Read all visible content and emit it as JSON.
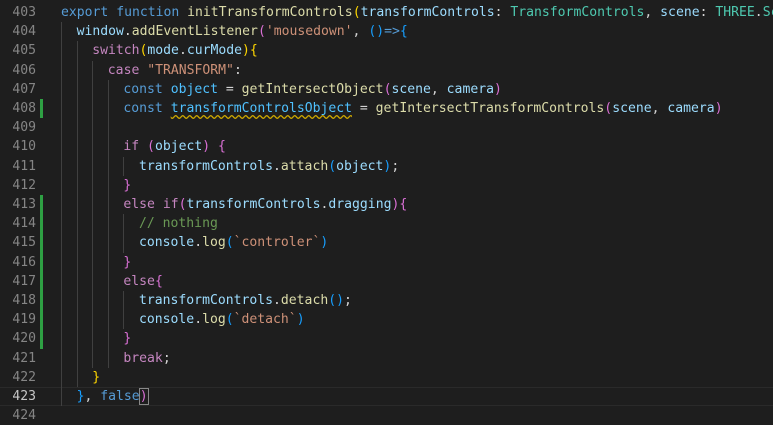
{
  "lines": [
    {
      "num": "403",
      "indent": 0,
      "git": false,
      "current": false,
      "tokens": [
        [
          "export ",
          "kw"
        ],
        [
          "function ",
          "kw"
        ],
        [
          "initTransformControls",
          "fn"
        ],
        [
          "(",
          "b1"
        ],
        [
          "transformControls",
          "var"
        ],
        [
          ": ",
          "txt"
        ],
        [
          "TransformControls",
          "typ"
        ],
        [
          ", ",
          "txt"
        ],
        [
          "scene",
          "var"
        ],
        [
          ": ",
          "txt"
        ],
        [
          "THREE",
          "typ"
        ],
        [
          ".",
          "txt"
        ],
        [
          "Scene",
          "typ"
        ]
      ]
    },
    {
      "num": "404",
      "indent": 1,
      "git": false,
      "current": false,
      "tokens": [
        [
          "window",
          "var"
        ],
        [
          ".",
          "txt"
        ],
        [
          "addEventListener",
          "fn"
        ],
        [
          "(",
          "b2"
        ],
        [
          "'mousedown'",
          "str"
        ],
        [
          ", ",
          "txt"
        ],
        [
          "()",
          "b3"
        ],
        [
          "=>",
          "kw"
        ],
        [
          "{",
          "b3"
        ]
      ]
    },
    {
      "num": "405",
      "indent": 2,
      "git": false,
      "current": false,
      "tokens": [
        [
          "switch",
          "ctl"
        ],
        [
          "(",
          "b1"
        ],
        [
          "mode",
          "var"
        ],
        [
          ".",
          "txt"
        ],
        [
          "curMode",
          "var"
        ],
        [
          ")",
          "b1"
        ],
        [
          "{",
          "b1"
        ]
      ]
    },
    {
      "num": "406",
      "indent": 3,
      "git": false,
      "current": false,
      "tokens": [
        [
          "case ",
          "ctl"
        ],
        [
          "\"TRANSFORM\"",
          "str"
        ],
        [
          ":",
          "txt"
        ]
      ]
    },
    {
      "num": "407",
      "indent": 4,
      "git": false,
      "current": false,
      "tokens": [
        [
          "const ",
          "kw"
        ],
        [
          "object",
          "cst"
        ],
        [
          " = ",
          "txt"
        ],
        [
          "getIntersectObject",
          "fn"
        ],
        [
          "(",
          "b2"
        ],
        [
          "scene",
          "var"
        ],
        [
          ", ",
          "txt"
        ],
        [
          "camera",
          "var"
        ],
        [
          ")",
          "b2"
        ]
      ]
    },
    {
      "num": "408",
      "indent": 4,
      "git": true,
      "current": false,
      "tokens": [
        [
          "const ",
          "kw"
        ],
        [
          "transformControlsObject",
          "cst",
          "warn"
        ],
        [
          " = ",
          "txt"
        ],
        [
          "getIntersectTransformControls",
          "fn"
        ],
        [
          "(",
          "b2"
        ],
        [
          "scene",
          "var"
        ],
        [
          ", ",
          "txt"
        ],
        [
          "camera",
          "var"
        ],
        [
          ")",
          "b2"
        ]
      ]
    },
    {
      "num": "409",
      "indent": 4,
      "git": false,
      "current": false,
      "tokens": []
    },
    {
      "num": "410",
      "indent": 4,
      "git": false,
      "current": false,
      "tokens": [
        [
          "if ",
          "ctl"
        ],
        [
          "(",
          "b2"
        ],
        [
          "object",
          "var"
        ],
        [
          ")",
          "b2"
        ],
        [
          " ",
          "txt"
        ],
        [
          "{",
          "b2"
        ]
      ]
    },
    {
      "num": "411",
      "indent": 5,
      "git": false,
      "current": false,
      "tokens": [
        [
          "transformControls",
          "var"
        ],
        [
          ".",
          "txt"
        ],
        [
          "attach",
          "fn"
        ],
        [
          "(",
          "b3"
        ],
        [
          "object",
          "var"
        ],
        [
          ")",
          "b3"
        ],
        [
          ";",
          "txt"
        ]
      ]
    },
    {
      "num": "412",
      "indent": 4,
      "git": false,
      "current": false,
      "tokens": [
        [
          "}",
          "b2"
        ]
      ]
    },
    {
      "num": "413",
      "indent": 4,
      "git": true,
      "current": false,
      "tokens": [
        [
          "else ",
          "ctl"
        ],
        [
          "if",
          "ctl"
        ],
        [
          "(",
          "b2"
        ],
        [
          "transformControls",
          "var"
        ],
        [
          ".",
          "txt"
        ],
        [
          "dragging",
          "var"
        ],
        [
          ")",
          "b2"
        ],
        [
          "{",
          "b2"
        ]
      ]
    },
    {
      "num": "414",
      "indent": 5,
      "git": true,
      "current": false,
      "tokens": [
        [
          "// nothing",
          "cmt"
        ]
      ]
    },
    {
      "num": "415",
      "indent": 5,
      "git": true,
      "current": false,
      "tokens": [
        [
          "console",
          "var"
        ],
        [
          ".",
          "txt"
        ],
        [
          "log",
          "fn"
        ],
        [
          "(",
          "b3"
        ],
        [
          "`controler`",
          "str"
        ],
        [
          ")",
          "b3"
        ]
      ]
    },
    {
      "num": "416",
      "indent": 4,
      "git": true,
      "current": false,
      "tokens": [
        [
          "}",
          "b2"
        ]
      ]
    },
    {
      "num": "417",
      "indent": 4,
      "git": true,
      "current": false,
      "tokens": [
        [
          "else",
          "ctl"
        ],
        [
          "{",
          "b2"
        ]
      ]
    },
    {
      "num": "418",
      "indent": 5,
      "git": true,
      "current": false,
      "tokens": [
        [
          "transformControls",
          "var"
        ],
        [
          ".",
          "txt"
        ],
        [
          "detach",
          "fn"
        ],
        [
          "()",
          "b3"
        ],
        [
          ";",
          "txt"
        ]
      ]
    },
    {
      "num": "419",
      "indent": 5,
      "git": true,
      "current": false,
      "tokens": [
        [
          "console",
          "var"
        ],
        [
          ".",
          "txt"
        ],
        [
          "log",
          "fn"
        ],
        [
          "(",
          "b3"
        ],
        [
          "`detach`",
          "str"
        ],
        [
          ")",
          "b3"
        ]
      ]
    },
    {
      "num": "420",
      "indent": 4,
      "git": true,
      "current": false,
      "tokens": [
        [
          "}",
          "b2"
        ]
      ]
    },
    {
      "num": "421",
      "indent": 4,
      "git": false,
      "current": false,
      "tokens": [
        [
          "break",
          "ctl"
        ],
        [
          ";",
          "txt"
        ]
      ]
    },
    {
      "num": "422",
      "indent": 2,
      "git": false,
      "current": false,
      "tokens": [
        [
          "}",
          "b1"
        ]
      ]
    },
    {
      "num": "423",
      "indent": 1,
      "git": false,
      "current": true,
      "tokens": [
        [
          "}",
          "b3"
        ],
        [
          ", ",
          "txt"
        ],
        [
          "false",
          "kw"
        ],
        [
          ")",
          "b2",
          "match"
        ]
      ]
    },
    {
      "num": "424",
      "indent": 0,
      "git": false,
      "current": false,
      "tokens": []
    }
  ]
}
